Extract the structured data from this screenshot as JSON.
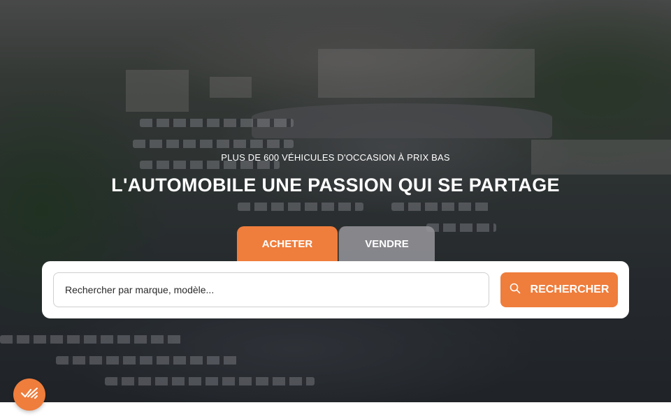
{
  "hero": {
    "subtitle": "PLUS DE 600 VÉHICULES D'OCCASION À PRIX BAS",
    "title": "L'AUTOMOBILE UNE PASSION QUI SE PARTAGE"
  },
  "tabs": [
    {
      "label": "ACHETER",
      "active": true
    },
    {
      "label": "VENDRE",
      "active": false
    }
  ],
  "search": {
    "placeholder": "Rechercher par marque, modèle...",
    "value": "",
    "button_label": "RECHERCHER",
    "button_icon": "search-icon"
  },
  "fab": {
    "icon": "cookie-consent-icon"
  },
  "colors": {
    "accent": "#ef7d3c",
    "tab_inactive": "#96969b",
    "panel": "#ffffff"
  }
}
